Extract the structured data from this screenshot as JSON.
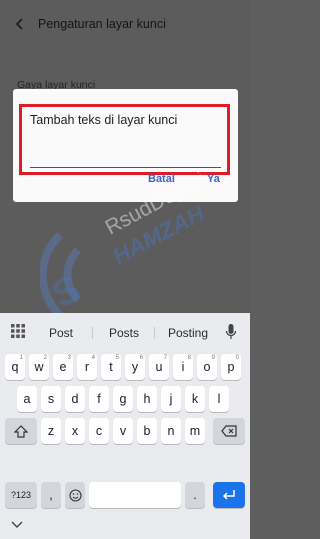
{
  "header": {
    "title": "Pengaturan layar kunci"
  },
  "section": {
    "label": "Gaya layar kunci"
  },
  "dialog": {
    "input_text": "Tambah teks di layar kunci",
    "cancel_label": "Batal",
    "ok_label": "Ya"
  },
  "keyboard": {
    "suggestions": [
      "Post",
      "Posts",
      "Posting"
    ],
    "row1": [
      "q",
      "w",
      "e",
      "r",
      "t",
      "y",
      "u",
      "i",
      "o",
      "p"
    ],
    "row1_hints": [
      "1",
      "2",
      "3",
      "4",
      "5",
      "6",
      "7",
      "8",
      "9",
      "0"
    ],
    "row2": [
      "a",
      "s",
      "d",
      "f",
      "g",
      "h",
      "j",
      "k",
      "l"
    ],
    "row3": [
      "z",
      "x",
      "c",
      "v",
      "b",
      "n",
      "m"
    ],
    "symbols_label": "?123",
    "comma_label": ",",
    "period_label": "."
  },
  "colors": {
    "highlight": "#e01b24",
    "accent": "#3b63c8",
    "enter_key": "#1a73e8"
  },
  "icons": [
    "back-arrow-icon",
    "keyboard-grid-icon",
    "microphone-icon",
    "shift-icon",
    "backspace-icon",
    "emoji-icon",
    "enter-icon",
    "hide-keyboard-icon"
  ]
}
